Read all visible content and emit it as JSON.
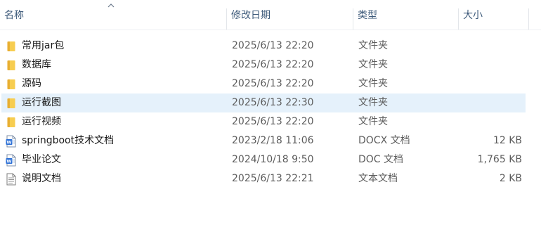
{
  "columns": {
    "name": "名称",
    "date": "修改日期",
    "type": "类型",
    "size": "大小"
  },
  "colors": {
    "folder": "#f5c342",
    "selected_row": "#e5f1fb",
    "header_text": "#3d5a7a",
    "word_blue": "#2b6fd6"
  },
  "files": [
    {
      "name": "常用jar包",
      "date": "2025/6/13 22:20",
      "type": "文件夹",
      "size": "",
      "icon": "folder-icon"
    },
    {
      "name": "数据库",
      "date": "2025/6/13 22:20",
      "type": "文件夹",
      "size": "",
      "icon": "folder-icon"
    },
    {
      "name": "源码",
      "date": "2025/6/13 22:20",
      "type": "文件夹",
      "size": "",
      "icon": "folder-icon"
    },
    {
      "name": "运行截图",
      "date": "2025/6/13 22:30",
      "type": "文件夹",
      "size": "",
      "icon": "folder-icon",
      "selected": true
    },
    {
      "name": "运行视频",
      "date": "2025/6/13 22:20",
      "type": "文件夹",
      "size": "",
      "icon": "folder-icon"
    },
    {
      "name": "springboot技术文档",
      "date": "2023/2/18 11:06",
      "type": "DOCX 文档",
      "size": "12 KB",
      "icon": "word-doc-icon"
    },
    {
      "name": "毕业论文",
      "date": "2024/10/18 9:50",
      "type": "DOC 文档",
      "size": "1,765 KB",
      "icon": "word-doc-icon"
    },
    {
      "name": "说明文档",
      "date": "2025/6/13 22:21",
      "type": "文本文档",
      "size": "2 KB",
      "icon": "text-doc-icon"
    }
  ]
}
